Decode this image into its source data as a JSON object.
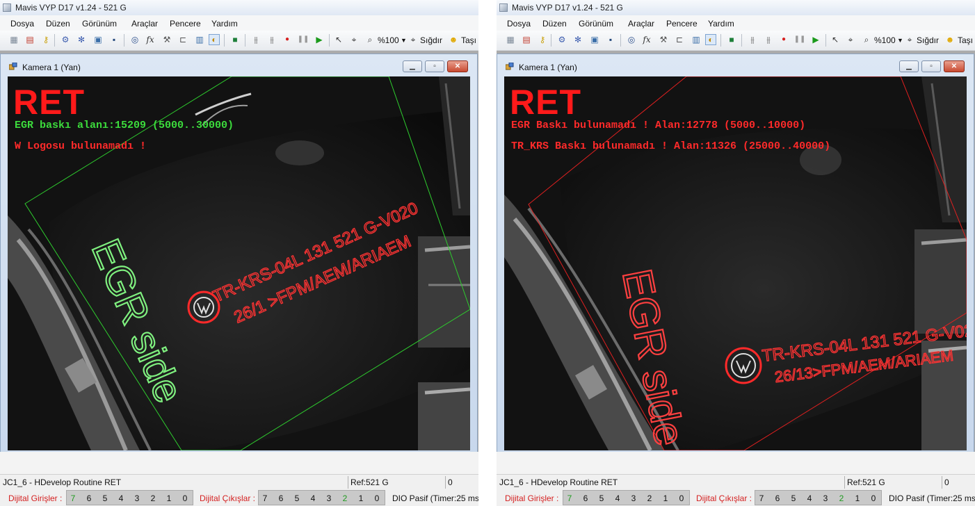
{
  "windows": [
    {
      "id": "left",
      "app_title": "Mavis VYP D17 v1.24 - 521 G",
      "menu": [
        "Dosya",
        "Düzen",
        "Görünüm",
        "Araçlar",
        "Pencere",
        "Yardım"
      ],
      "toolbar": {
        "zoom": "%100",
        "fit": "Sığdır",
        "move": "Taşı"
      },
      "child_title": "Kamera 1 (Yan)",
      "overlay": {
        "status": "RET",
        "line1": "EGR baskı alanı:15209 (5000..30000)",
        "line2": "W Logosu bulunamadı !",
        "line1_color": "green",
        "line2_color": "red"
      },
      "roi_color": "#2ecc2e",
      "statusbar": {
        "routine": "JC1_6 - HDevelop Routine RET",
        "ref": "Ref:521 G",
        "count": "0"
      },
      "io": {
        "inputs_label": "Dijital Girişler :",
        "input_bits": [
          "7",
          "6",
          "5",
          "4",
          "3",
          "2",
          "1",
          "0"
        ],
        "input_active": [
          "7"
        ],
        "outputs_label": "Dijital Çıkışlar :",
        "output_bits": [
          "7",
          "6",
          "5",
          "4",
          "3",
          "2",
          "1",
          "0"
        ],
        "output_active": [
          "2"
        ],
        "dio_status": "DIO Pasif (Timer:25 ms."
      }
    },
    {
      "id": "right",
      "app_title": "Mavis VYP D17 v1.24 - 521 G",
      "menu": [
        "Dosya",
        "Düzen",
        "Görünüm",
        "Araçlar",
        "Pencere",
        "Yardım"
      ],
      "toolbar": {
        "zoom": "%100",
        "fit": "Sığdır",
        "move": "Taşı"
      },
      "child_title": "Kamera 1 (Yan)",
      "overlay": {
        "status": "RET",
        "line1": "EGR Baskı bulunamadı ! Alan:12778 (5000..10000)",
        "line2": "TR_KRS Baskı bulunamadı ! Alan:11326 (25000..40000)",
        "line1_color": "red",
        "line2_color": "red"
      },
      "roi_color": "#e02020",
      "statusbar": {
        "routine": "JC1_6 - HDevelop Routine RET",
        "ref": "Ref:521 G",
        "count": "0"
      },
      "io": {
        "inputs_label": "Dijital Girişler :",
        "input_bits": [
          "7",
          "6",
          "5",
          "4",
          "3",
          "2",
          "1",
          "0"
        ],
        "input_active": [
          "7"
        ],
        "outputs_label": "Dijital Çıkışlar :",
        "output_bits": [
          "7",
          "6",
          "5",
          "4",
          "3",
          "2",
          "1",
          "0"
        ],
        "output_active": [
          "2"
        ],
        "dio_status": "DIO Pasif (Timer:25 ms."
      }
    }
  ],
  "image_text": {
    "egr_side": "EGR side",
    "print_line1_left": "TR-KRS-04L 131 521 G-V020",
    "print_line2_left": "26/1 >FPM/AEM/ARIAEM",
    "print_line1_right": "TR-KRS-04L 131 521 G-V02",
    "print_line2_right": "26/13>FPM/AEM/ARIAEM"
  }
}
